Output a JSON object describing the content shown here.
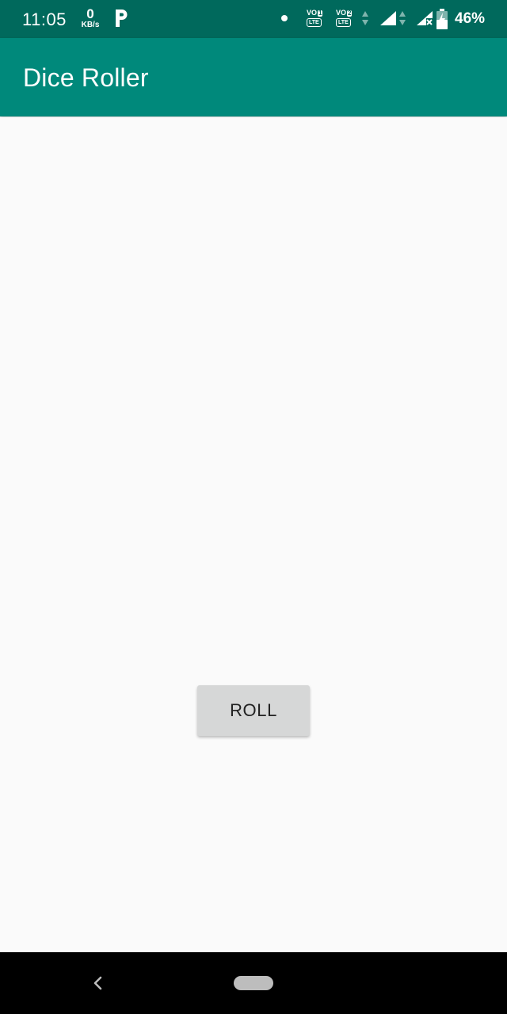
{
  "status_bar": {
    "time": "11:05",
    "net_speed_value": "0",
    "net_speed_unit": "KB/s",
    "sim1": {
      "vo": "VO",
      "slot": "1",
      "lte": "LTE"
    },
    "sim2": {
      "vo": "VO",
      "slot": "2",
      "lte": "LTE"
    },
    "battery_percent": "46%",
    "icons": [
      "parking-app-icon",
      "notification-dot-icon",
      "volte-sim1-icon",
      "volte-sim2-icon",
      "data-arrows-icon",
      "signal-icon",
      "signal-no-service-icon",
      "battery-charging-icon"
    ]
  },
  "app_bar": {
    "title": "Dice Roller"
  },
  "main": {
    "roll_button_label": "ROLL"
  },
  "nav_bar": {
    "icons": [
      "back-icon",
      "home-pill-icon"
    ]
  },
  "colors": {
    "status_bar": "#00695c",
    "app_bar": "#00897b",
    "background": "#fafafa",
    "button": "#d6d7d7"
  }
}
